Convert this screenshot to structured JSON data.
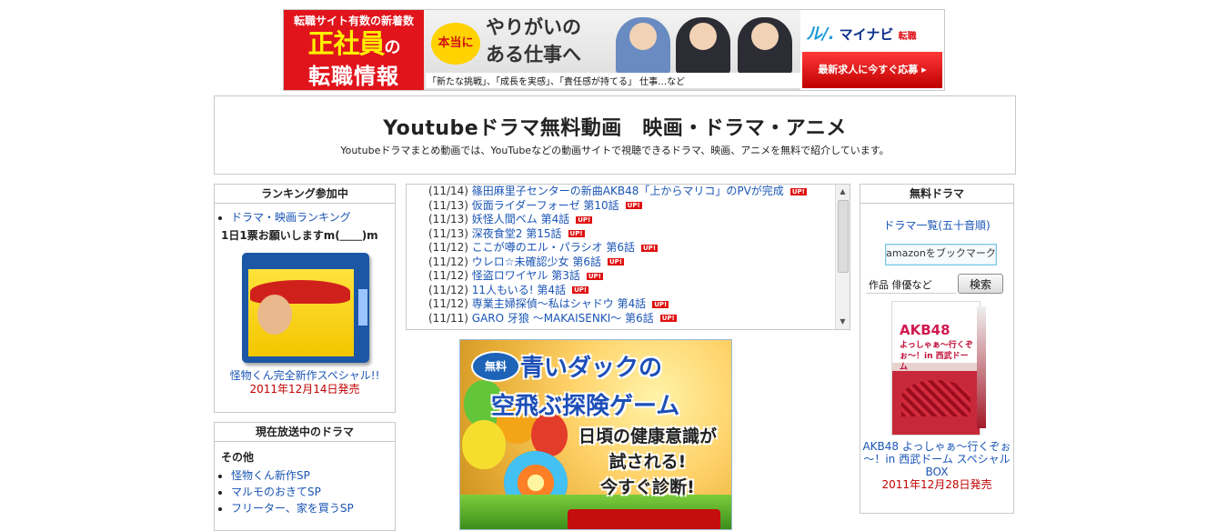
{
  "banner": {
    "line1": "転職サイト有数の新着数",
    "line2a": "正社員",
    "line2b": "の",
    "line3": "転職情報",
    "bubble": "本当に",
    "headline1": "やりがいの",
    "headline2": "ある仕事へ",
    "subline": "「新たな挑戦」、「成長を実感」、「責任感が持てる」 仕事…など",
    "logo": "マイナビ",
    "logo_sub": "転職",
    "cta": "最新求人に今すぐ応募 ▸"
  },
  "header": {
    "title": "Youtubeドラマ無料動画　映画・ドラマ・アニメ",
    "description": "Youtubeドラマまとめ動画では、YouTubeなどの動画サイトで視聴できるドラマ、映画、アニメを無料で紹介しています。"
  },
  "ranking": {
    "title": "ランキング参加中",
    "link": "ドラマ・映画ランキング",
    "please": "1日1票お願いしますm(＿＿)m",
    "product_title": "怪物くん完全新作スペシャル!!",
    "product_date": "2011年12月14日発売"
  },
  "onair": {
    "title": "現在放送中のドラマ",
    "category": "その他",
    "items": [
      "怪物くん新作SP",
      "マルモのおきてSP",
      "フリーター、家を買うSP"
    ]
  },
  "news": {
    "up_label": "UP!",
    "items": [
      {
        "date": "(11/14)",
        "title": "篠田麻里子センターの新曲AKB48「上からマリコ」のPVが完成"
      },
      {
        "date": "(11/13)",
        "title": "仮面ライダーフォーゼ 第10話"
      },
      {
        "date": "(11/13)",
        "title": "妖怪人間ベム 第4話"
      },
      {
        "date": "(11/13)",
        "title": "深夜食堂2 第15話"
      },
      {
        "date": "(11/12)",
        "title": "ここが噂のエル・パラシオ 第6話"
      },
      {
        "date": "(11/12)",
        "title": "ウレロ☆未確認少女 第6話"
      },
      {
        "date": "(11/12)",
        "title": "怪盗ロワイヤル 第3話"
      },
      {
        "date": "(11/12)",
        "title": "11人もいる! 第4話"
      },
      {
        "date": "(11/12)",
        "title": "専業主婦探偵～私はシャドウ 第4話"
      },
      {
        "date": "(11/11)",
        "title": "GARO 牙狼 ～MAKAISENKI～ 第6話"
      }
    ]
  },
  "game_ad": {
    "free": "無料",
    "title1": "青いダックの",
    "title2": "空飛ぶ探険ゲーム",
    "message1": "日頃の健康意識が",
    "message2": "試される!",
    "message3": "今すぐ診断!"
  },
  "free_drama": {
    "title": "無料ドラマ",
    "link": "ドラマ一覧(五十音順)",
    "amazon": "amazonをブックマーク",
    "search_value": "作品 俳優など",
    "search_button": "検索",
    "product_logo": "AKB48",
    "product_text": "よっしゃぁ～行くぞぉ～！in 西武ドーム",
    "product_title": "AKB48 よっしゃぁ～行くぞぉ～！in 西武ドーム スペシャルBOX",
    "product_date": "2011年12月28日発売"
  },
  "colors": {
    "link": "#1a55b5",
    "date_red": "#c00000",
    "banner_red": "#e1141c",
    "border": "#c9c9c9"
  }
}
